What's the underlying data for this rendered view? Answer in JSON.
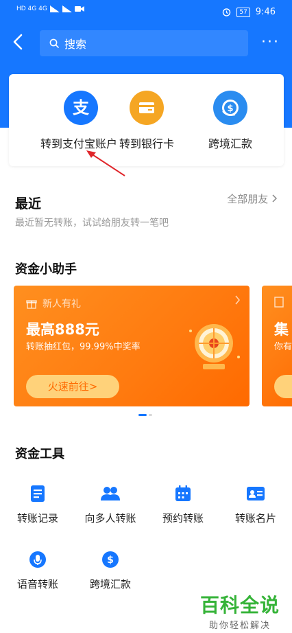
{
  "status_bar": {
    "left_text": "HD 4G 4G",
    "battery": "57",
    "time": "9:46"
  },
  "nav": {
    "search_placeholder": "搜索",
    "more": "···"
  },
  "top_actions": [
    {
      "label": "转到支付宝账户",
      "icon": "alipay-icon",
      "color": "#1677ff"
    },
    {
      "label": "转到银行卡",
      "icon": "bank-card-icon",
      "color": "#f5a623"
    },
    {
      "label": "跨境汇款",
      "icon": "cross-border-icon",
      "color": "#2a8cf0"
    }
  ],
  "recent": {
    "title": "最近",
    "link": "全部朋友",
    "empty_text": "最近暂无转账，试试给朋友转一笔吧"
  },
  "assistant": {
    "title": "资金小助手",
    "cards": [
      {
        "tag": "新人有礼",
        "headline": "最高888元",
        "sub": "转账抽红包，99.99%中奖率",
        "cta": "火速前往>"
      },
      {
        "headline": "集",
        "sub": "你有"
      }
    ]
  },
  "tools": {
    "title": "资金工具",
    "items": [
      {
        "label": "转账记录",
        "icon": "record-icon"
      },
      {
        "label": "向多人转账",
        "icon": "multi-user-icon"
      },
      {
        "label": "预约转账",
        "icon": "calendar-icon"
      },
      {
        "label": "转账名片",
        "icon": "card-icon"
      },
      {
        "label": "语音转账",
        "icon": "microphone-icon"
      },
      {
        "label": "跨境汇款",
        "icon": "dollar-icon"
      }
    ]
  },
  "watermark": {
    "main": "百科全说",
    "sub": "助你轻松解决"
  },
  "colors": {
    "brand_blue": "#1677ff",
    "promo_orange": "#ff8f1f",
    "watermark_green": "#35b338"
  }
}
